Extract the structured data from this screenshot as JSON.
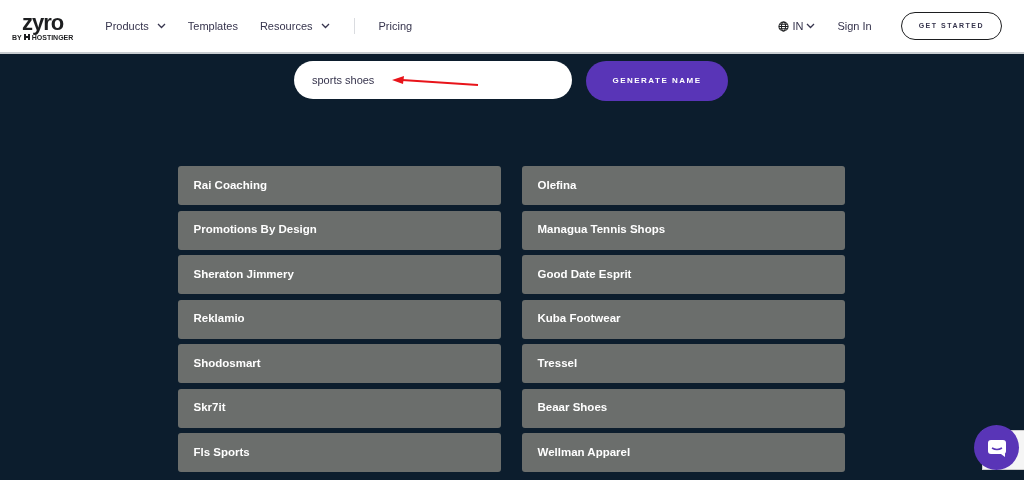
{
  "header": {
    "logo": "zyro",
    "logo_sub": "BY",
    "logo_brand": "HOSTINGER",
    "nav": [
      {
        "label": "Products",
        "dropdown": true
      },
      {
        "label": "Templates",
        "dropdown": false
      },
      {
        "label": "Resources",
        "dropdown": true
      },
      {
        "label": "Pricing",
        "dropdown": false
      }
    ],
    "language": "IN",
    "sign_in": "Sign In",
    "cta": "GET STARTED"
  },
  "search": {
    "value": "sports shoes",
    "button": "GENERATE NAME"
  },
  "names": [
    [
      "Rai Coaching",
      "Olefina"
    ],
    [
      "Promotions By Design",
      "Managua Tennis Shops"
    ],
    [
      "Sheraton Jimmery",
      "Good Date Esprit"
    ],
    [
      "Reklamio",
      "Kuba Footwear"
    ],
    [
      "Shodosmart",
      "Tressel"
    ],
    [
      "Skr7it",
      "Beaar Shoes"
    ],
    [
      "Fls Sports",
      "Wellman Apparel"
    ]
  ]
}
